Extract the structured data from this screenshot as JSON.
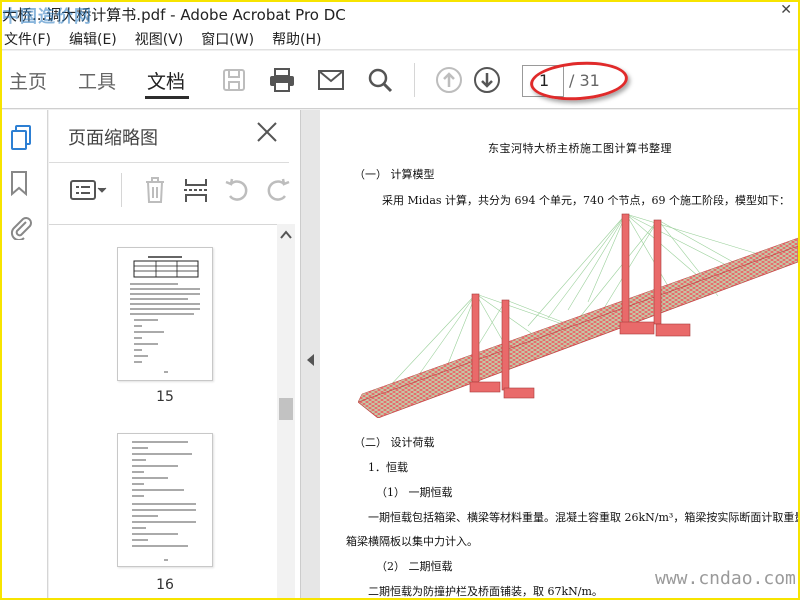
{
  "window": {
    "title": "大桥...调大桥计算书.pdf - Adobe Acrobat Pro DC",
    "watermark": "中国造价网"
  },
  "menu": [
    "文件(F)",
    "编辑(E)",
    "视图(V)",
    "窗口(W)",
    "帮助(H)"
  ],
  "tabs": [
    "主页",
    "工具",
    "文档"
  ],
  "toolbar": {
    "icons": [
      "save-icon",
      "print-icon",
      "mail-icon",
      "search-icon",
      "prev-page-icon",
      "next-page-icon"
    ],
    "page_current": "1",
    "page_total": "/ 31"
  },
  "sidebar": {
    "icons": [
      "page-thumbnails-icon",
      "bookmark-icon",
      "attachment-icon"
    ]
  },
  "panel": {
    "title": "页面缩略图",
    "tools": [
      "thumbnail-options-icon",
      "delete-icon",
      "extract-icon",
      "rotate-left-icon",
      "rotate-right-icon"
    ],
    "thumbnails": [
      {
        "label": "15"
      },
      {
        "label": "16"
      }
    ]
  },
  "document": {
    "title": "东宝河特大桥主桥施工图计算书整理",
    "lines": [
      "（一） 计算模型",
      "采用 Midas 计算，共分为 694 个单元，740 个节点，69 个施工阶段，模型如下：",
      "（二） 设计荷载",
      "1．恒载",
      "（1） 一期恒载",
      "一期恒载包括箱梁、横梁等材料重量。混凝土容重取 26kN/m³，箱梁按实际断面计取重量，",
      "箱梁横隔板以集中力计入。",
      "（2） 二期恒载",
      "二期恒载为防撞护栏及桥面铺装，取 67kN/m。"
    ]
  },
  "watermark_bottom": "www.cndao.com"
}
